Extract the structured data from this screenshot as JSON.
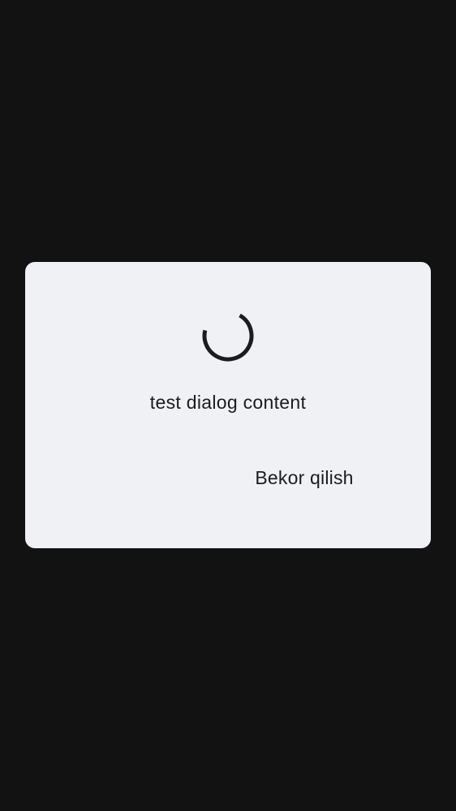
{
  "dialog": {
    "content": "test dialog content",
    "cancel_label": "Bekor qilish",
    "spinner_icon": "progress-spinner-icon"
  },
  "colors": {
    "backdrop": "#121212",
    "dialog_background": "#f0f1f5",
    "text": "#1c1c1e",
    "spinner": "#1c1c1e"
  }
}
